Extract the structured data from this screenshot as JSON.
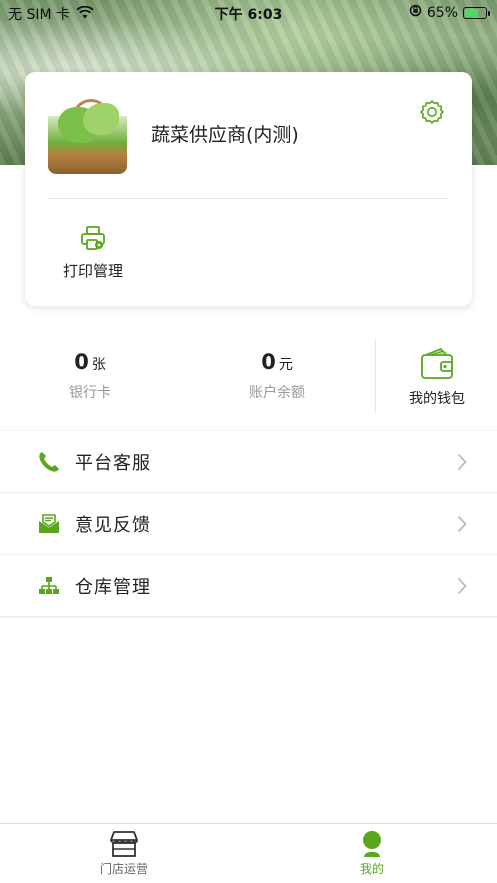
{
  "status_bar": {
    "carrier": "无 SIM 卡",
    "time": "下午 6:03",
    "battery": "65%"
  },
  "profile": {
    "store_name": "蔬菜供应商(内测)",
    "actions": [
      {
        "label": "打印管理",
        "icon": "printer-icon"
      }
    ]
  },
  "stats": {
    "bank_card": {
      "value": "0",
      "unit": "张",
      "label": "银行卡"
    },
    "balance": {
      "value": "0",
      "unit": "元",
      "label": "账户余额"
    },
    "wallet_label": "我的钱包"
  },
  "menu": [
    {
      "label": "平台客服",
      "icon": "phone-icon"
    },
    {
      "label": "意见反馈",
      "icon": "feedback-mail-icon"
    },
    {
      "label": "仓库管理",
      "icon": "warehouse-tree-icon"
    }
  ],
  "tabbar": {
    "tabs": [
      {
        "label": "门店运营",
        "icon": "storefront-icon",
        "active": false
      },
      {
        "label": "我的",
        "icon": "user-icon",
        "active": true
      }
    ]
  },
  "colors": {
    "accent": "#5aa61e",
    "text": "#222222",
    "muted": "#999999"
  }
}
